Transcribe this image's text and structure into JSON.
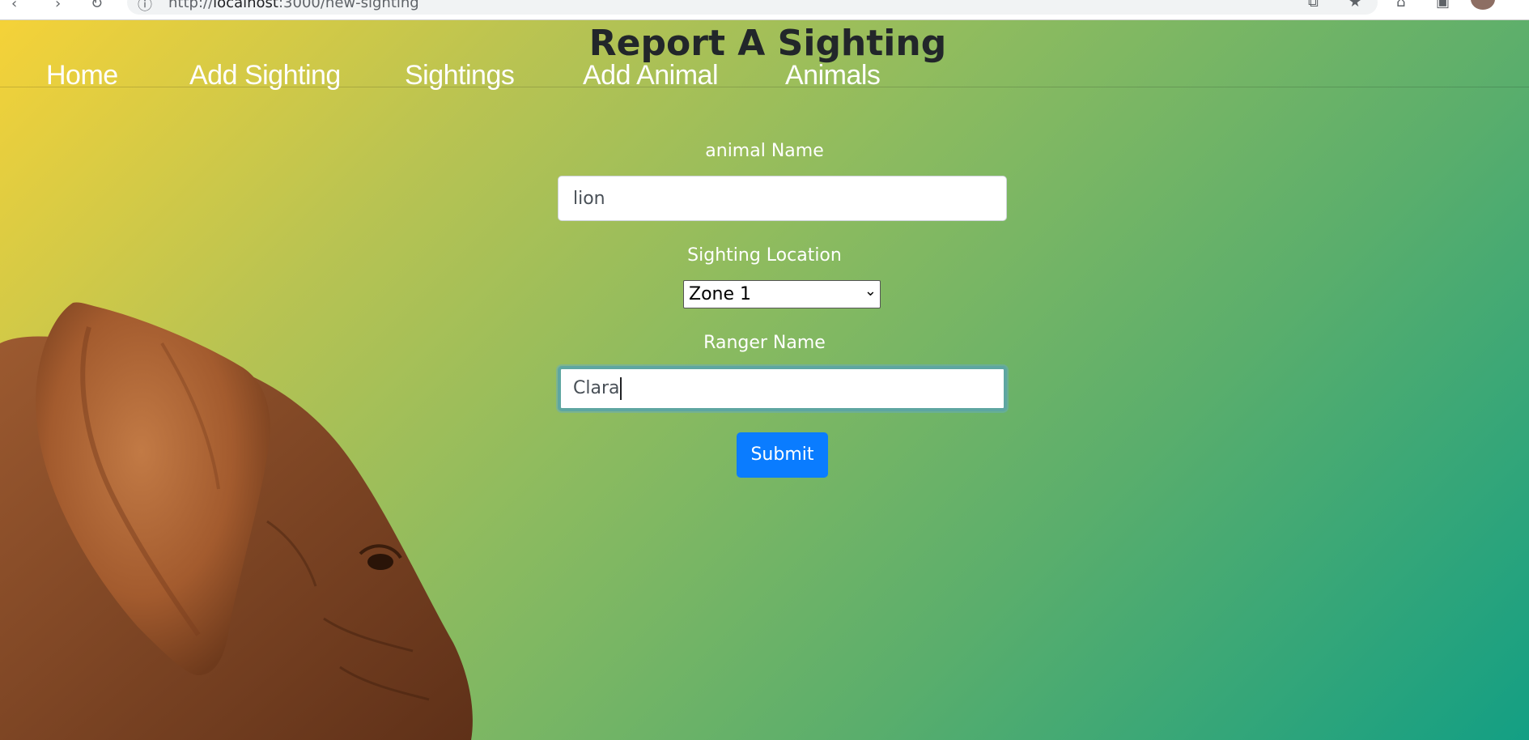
{
  "browser": {
    "url_prefix": "http://",
    "url_host": "localhost",
    "url_rest": ":3000/new-sighting",
    "back_icon": "back-arrow-icon",
    "forward_icon": "forward-arrow-icon",
    "reload_icon": "reload-icon"
  },
  "page": {
    "title": "Report A Sighting"
  },
  "nav": {
    "items": [
      {
        "label": "Home"
      },
      {
        "label": "Add Sighting"
      },
      {
        "label": "Sightings"
      },
      {
        "label": "Add Animal"
      },
      {
        "label": "Animals"
      }
    ]
  },
  "form": {
    "animal_name_label": "animal Name",
    "animal_name_value": "lion",
    "location_label": "Sighting Location",
    "location_selected": "Zone 1",
    "ranger_name_label": "Ranger Name",
    "ranger_name_value": "Clara",
    "submit_label": "Submit"
  },
  "colors": {
    "gradient_start": "#f5d238",
    "gradient_end": "#139f84",
    "submit_button": "#0a7cff"
  }
}
